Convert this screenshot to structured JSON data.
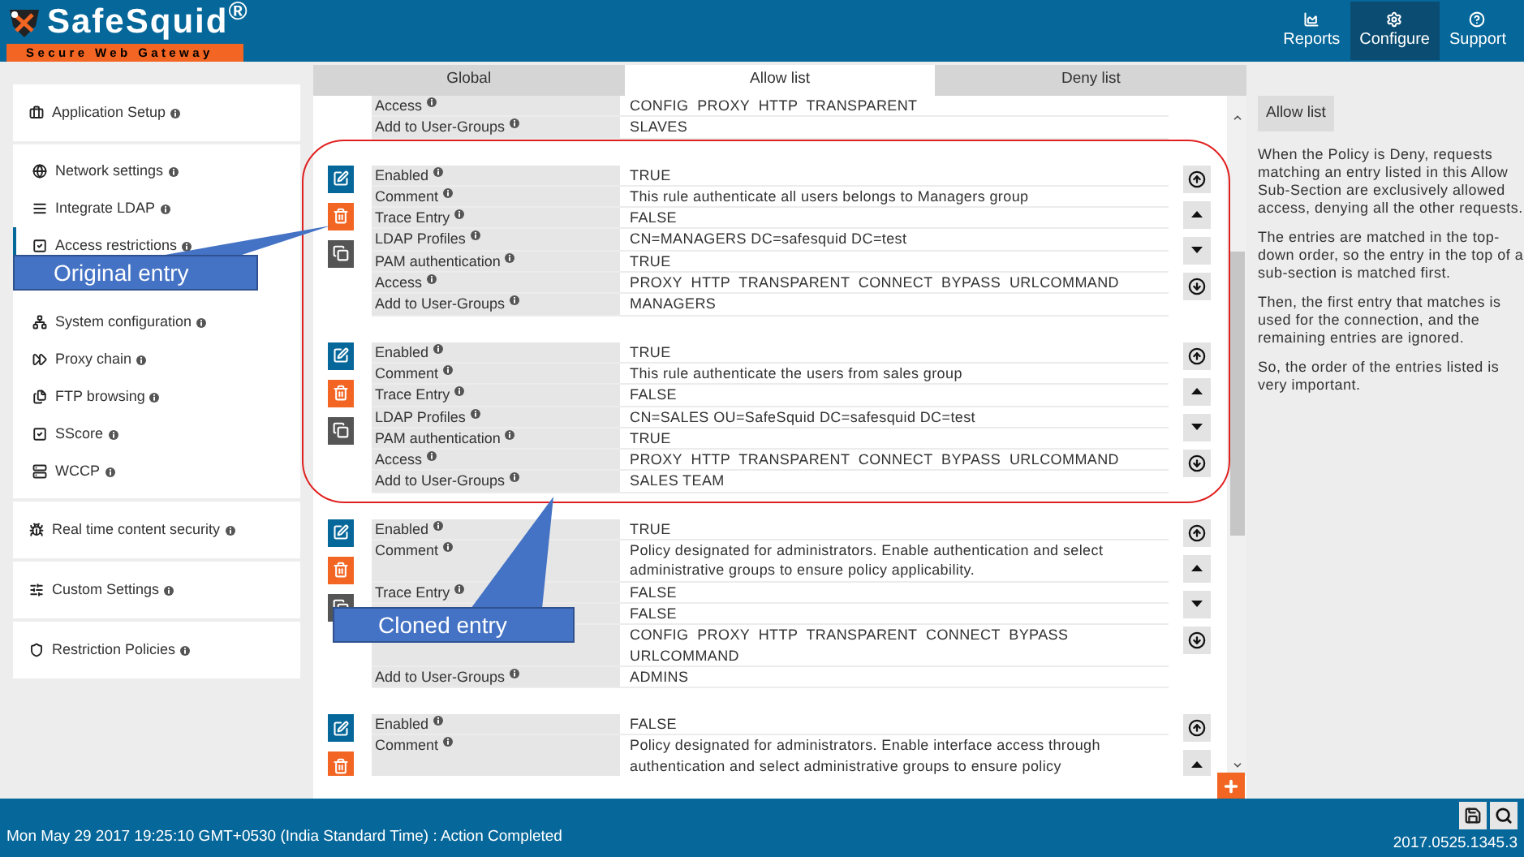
{
  "header": {
    "logo": {
      "name": "SafeSquid$^{®}$",
      "tagline": "Secure Web Gateway"
    },
    "nav": [
      {
        "label": "Reports",
        "selected": false
      },
      {
        "label": "Configure",
        "selected": true
      },
      {
        "label": "Support",
        "selected": false
      }
    ]
  },
  "sidebar": {
    "groups": [
      {
        "items": [
          {
            "label": "Application Setup",
            "selected": false
          }
        ]
      },
      {
        "items": [
          {
            "label": "Network settings",
            "selected": false
          },
          {
            "label": "Integrate LDAP",
            "selected": false
          },
          {
            "label": "Access restrictions",
            "selected": true
          },
          {
            "label": "System configuration",
            "selected": false
          },
          {
            "label": "Proxy chain",
            "selected": false
          },
          {
            "label": "FTP browsing",
            "selected": false
          },
          {
            "label": "SScore",
            "selected": false
          },
          {
            "label": "WCCP",
            "selected": false
          }
        ]
      },
      {
        "items": [
          {
            "label": "Real time content security",
            "selected": false
          }
        ]
      },
      {
        "items": [
          {
            "label": "Custom Settings",
            "selected": false
          }
        ]
      },
      {
        "items": [
          {
            "label": "Restriction Policies",
            "selected": false
          }
        ]
      }
    ]
  },
  "tabs": [
    {
      "label": "Global",
      "selected": false
    },
    {
      "label": "Allow list",
      "selected": true
    },
    {
      "label": "Deny list",
      "selected": false
    }
  ],
  "entries": [
    {
      "cut_top": true,
      "fields": [
        {
          "label": "Access",
          "value": "CONFIG  PROXY  HTTP  TRANSPARENT"
        },
        {
          "label": "Add to User-Groups",
          "value": "SLAVES"
        }
      ]
    },
    {
      "cut_top": false,
      "fields": [
        {
          "label": "Enabled",
          "value": "TRUE"
        },
        {
          "label": "Comment",
          "value": "This rule authenticate all users belongs to Managers group"
        },
        {
          "label": "Trace Entry",
          "value": "FALSE"
        },
        {
          "label": "LDAP Profiles",
          "value": "CN=MANAGERS DC=safesquid DC=test"
        },
        {
          "label": "PAM authentication",
          "value": "TRUE"
        },
        {
          "label": "Access",
          "value": "PROXY  HTTP  TRANSPARENT  CONNECT  BYPASS  URLCOMMAND"
        },
        {
          "label": "Add to User-Groups",
          "value": "MANAGERS"
        }
      ]
    },
    {
      "cut_top": false,
      "fields": [
        {
          "label": "Enabled",
          "value": "TRUE"
        },
        {
          "label": "Comment",
          "value": "This rule authenticate the users from sales group"
        },
        {
          "label": "Trace Entry",
          "value": "FALSE"
        },
        {
          "label": "LDAP Profiles",
          "value": "CN=SALES OU=SafeSquid DC=safesquid DC=test"
        },
        {
          "label": "PAM authentication",
          "value": "TRUE"
        },
        {
          "label": "Access",
          "value": "PROXY  HTTP  TRANSPARENT  CONNECT  BYPASS  URLCOMMAND"
        },
        {
          "label": "Add to User-Groups",
          "value": "SALES TEAM"
        }
      ]
    },
    {
      "cut_top": false,
      "fields": [
        {
          "label": "Enabled",
          "value": "TRUE"
        },
        {
          "label": "Comment",
          "value": "Policy designated for administrators. Enable authentication and select administrative groups to ensure policy applicability."
        },
        {
          "label": "Trace Entry",
          "value": "FALSE"
        },
        {
          "value": "FALSE"
        },
        {
          "value": "CONFIG  PROXY  HTTP  TRANSPARENT  CONNECT  BYPASS  URLCOMMAND"
        },
        {
          "label": "Add to User-Groups",
          "value": "ADMINS"
        }
      ]
    },
    {
      "cut_top": false,
      "cut_bottom": true,
      "fields": [
        {
          "label": "Enabled",
          "value": "FALSE"
        },
        {
          "label": "Comment",
          "value": "Policy designated for administrators. Enable interface access through authentication and select administrative groups to ensure policy"
        }
      ]
    }
  ],
  "help": {
    "chip": "Allow list",
    "paragraphs": [
      "When the Policy is Deny, requests matching an entry listed in this Allow Sub-Section are exclusively allowed access, denying all the other requests.",
      "The entries are matched in the top-down order, so the entry in the top of a sub-section is matched first.",
      "Then, the first entry that matches is used for the connection, and the remaining entries are ignored.",
      "So, the order of the entries listed is very important."
    ]
  },
  "annotations": [
    {
      "text": "Original entry"
    },
    {
      "text": "Cloned entry"
    }
  ],
  "status_bar": {
    "message": "Mon May 29 2017 19:25:10 GMT+0530 (India Standard Time) : Action Completed",
    "version": "2017.0525.1345.3"
  }
}
